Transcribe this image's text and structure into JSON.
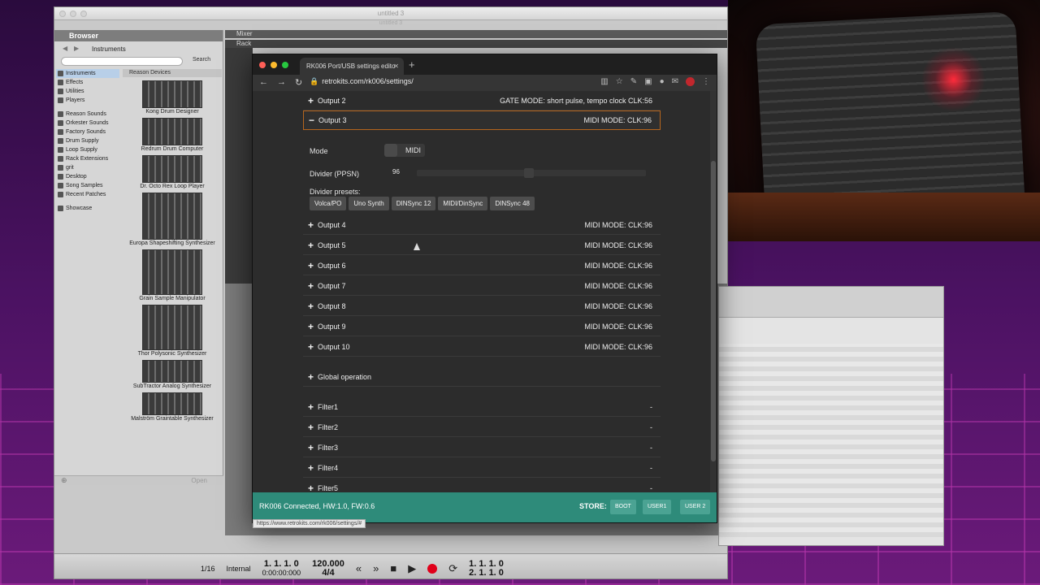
{
  "reason": {
    "window_title": "untitled 3",
    "window_title2": "untitled 3",
    "browser_header": "Browser",
    "mixer_label": "Mixer",
    "rack_label": "Rack",
    "crumb": "Instruments",
    "search_btn": "Search",
    "reason_devices": "Reason Devices",
    "categories_a": [
      "Instruments",
      "Effects",
      "Utilities",
      "Players"
    ],
    "categories_b": [
      "Reason Sounds",
      "Orkester Sounds",
      "Factory Sounds",
      "Drum Supply",
      "Loop Supply",
      "Rack Extensions",
      "grit",
      "Desktop",
      "Song Samples",
      "Recent Patches"
    ],
    "categories_c": [
      "Showcase"
    ],
    "devices": [
      "Kong Drum Designer",
      "Redrum Drum Computer",
      "Dr. Octo Rex Loop Player",
      "Europa Shapeshifting Synthesizer",
      "Grain Sample Manipulator",
      "Thor Polysonic Synthesizer",
      "SubTractor Analog Synthesizer",
      "Malström Graintable Synthesizer"
    ],
    "open_btn": "Open",
    "transport": {
      "quantize": "1/16",
      "sync": "Internal",
      "position": "1. 1. 1.   0",
      "time": "0:00:00:000",
      "tempo": "120.000",
      "signature": "4/4",
      "loop_l": "1. 1. 1.   0",
      "loop_r": "2. 1. 1.   0"
    }
  },
  "chrome": {
    "tab_title": "RK006 Port/USB settings edito",
    "url": "retrokits.com/rk006/settings/",
    "hover_url": "https://www.retrokits.com/rk006/settings/#"
  },
  "settings": {
    "output2": {
      "label": "Output 2",
      "value": "GATE MODE:  short pulse,  tempo clock  CLK:56"
    },
    "output3": {
      "label": "Output 3",
      "value": "MIDI MODE: CLK:96"
    },
    "mode_label": "Mode",
    "mode_value": "MIDI",
    "divider_label": "Divider (PPSN)",
    "divider_value": "96",
    "divider_fraction": 0.49,
    "presets_label": "Divider presets:",
    "presets": [
      "Volca/PO",
      "Uno Synth",
      "DINSync 12",
      "MIDI/DinSync",
      "DINSync 48"
    ],
    "outputs": [
      {
        "label": "Output 4",
        "value": "MIDI MODE: CLK:96"
      },
      {
        "label": "Output 5",
        "value": "MIDI MODE: CLK:96"
      },
      {
        "label": "Output 6",
        "value": "MIDI MODE: CLK:96"
      },
      {
        "label": "Output 7",
        "value": "MIDI MODE: CLK:96"
      },
      {
        "label": "Output 8",
        "value": "MIDI MODE: CLK:96"
      },
      {
        "label": "Output 9",
        "value": "MIDI MODE: CLK:96"
      },
      {
        "label": "Output 10",
        "value": "MIDI MODE: CLK:96"
      }
    ],
    "global": {
      "label": "Global operation"
    },
    "filters": [
      {
        "label": "Filter1",
        "value": "-"
      },
      {
        "label": "Filter2",
        "value": "-"
      },
      {
        "label": "Filter3",
        "value": "-"
      },
      {
        "label": "Filter4",
        "value": "-"
      },
      {
        "label": "Filter5",
        "value": "-"
      }
    ]
  },
  "status": {
    "connection": "RK006 Connected, HW:1.0, FW:0.6",
    "store_label": "STORE:",
    "boot": "BOOT",
    "user1": "USER1",
    "user2": "USER 2"
  },
  "colors": {
    "status_bar": "#2e8b7a",
    "open_outline": "#b5651d",
    "record": "#e0001a"
  }
}
